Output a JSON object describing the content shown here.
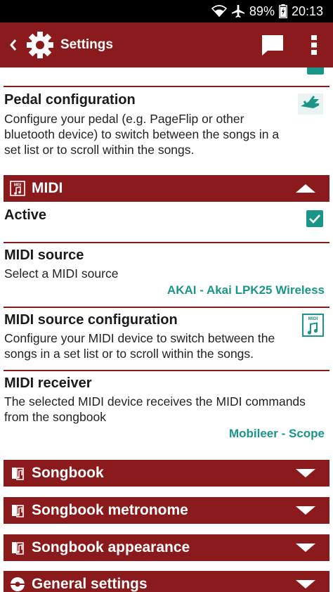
{
  "status_bar": {
    "battery": "89%",
    "time": "20:13"
  },
  "app_bar": {
    "title": "Settings"
  },
  "pedal": {
    "title": "Pedal configuration",
    "summary": "Configure your pedal (e.g. PageFlip or other bluetooth device) to switch between the songs in a set list or to scroll within the songs."
  },
  "midi_section": {
    "label": "MIDI",
    "icon_text": "MIDI",
    "expanded": true
  },
  "active": {
    "title": "Active",
    "checked": true
  },
  "midi_source": {
    "title": "MIDI source",
    "summary": "Select a MIDI source",
    "value": "AKAI - Akai LPK25 Wireless"
  },
  "midi_source_config": {
    "title": "MIDI source configuration",
    "summary": "Configure your MIDI device to switch between the songs in a set list or to scroll within the songs.",
    "icon_text": "MIDI"
  },
  "midi_receiver": {
    "title": "MIDI receiver",
    "summary": "The selected MIDI device receives the MIDI commands from the songbook",
    "value": "Mobileer - Scope"
  },
  "sections": [
    {
      "label": "Songbook"
    },
    {
      "label": "Songbook metronome"
    },
    {
      "label": "Songbook appearance"
    },
    {
      "label": "General settings"
    }
  ],
  "colors": {
    "primary": "#8b1a1d",
    "accent": "#1a9688"
  }
}
